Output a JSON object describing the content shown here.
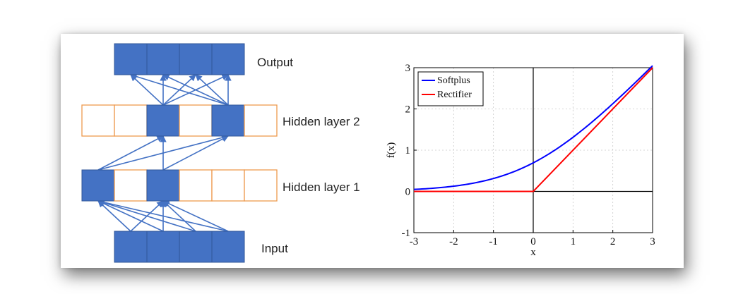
{
  "diagram": {
    "labels": {
      "output": "Output",
      "hidden2": "Hidden layer 2",
      "hidden1": "Hidden layer 1",
      "input": "Input"
    },
    "colors": {
      "active_fill": "#4472c4",
      "active_stroke": "#2f5597",
      "inactive_stroke": "#ed9a4e",
      "arrow": "#4472c4"
    },
    "layers": {
      "output": [
        true,
        true,
        true,
        true
      ],
      "hidden2": [
        false,
        false,
        true,
        false,
        true,
        false
      ],
      "hidden1": [
        true,
        false,
        true,
        false,
        false,
        false
      ],
      "input": [
        true,
        true,
        true,
        true
      ]
    }
  },
  "chart_data": {
    "type": "line",
    "xlabel": "x",
    "ylabel": "f(x)",
    "xlim": [
      -3,
      3
    ],
    "ylim": [
      -1,
      3
    ],
    "xticks": [
      -3,
      -2,
      -1,
      0,
      1,
      2,
      3
    ],
    "yticks": [
      -1,
      0,
      1,
      2,
      3
    ],
    "grid": true,
    "legend_position": "top-left",
    "series": [
      {
        "name": "Softplus",
        "color": "#0000ff",
        "x": [
          -3,
          -2.5,
          -2,
          -1.5,
          -1,
          -0.5,
          0,
          0.5,
          1,
          1.5,
          2,
          2.5,
          3
        ],
        "y": [
          0.049,
          0.079,
          0.127,
          0.201,
          0.313,
          0.474,
          0.693,
          0.974,
          1.313,
          1.701,
          2.127,
          2.579,
          3.049
        ]
      },
      {
        "name": "Rectifier",
        "color": "#ff0000",
        "x": [
          -3,
          0,
          3
        ],
        "y": [
          0,
          0,
          3
        ]
      }
    ]
  }
}
